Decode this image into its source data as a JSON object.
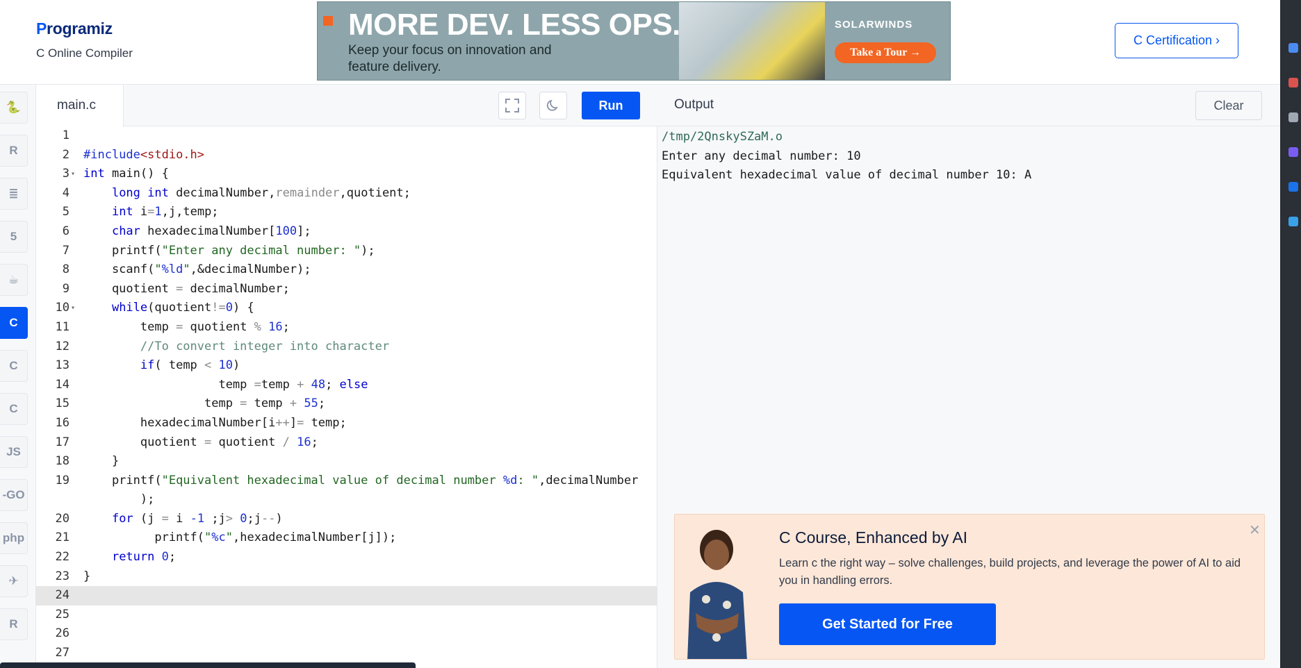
{
  "header": {
    "logo_text": "rogramiz",
    "logo_p": "P",
    "subtitle": "C Online Compiler",
    "cert_button": "C Certification ›"
  },
  "ad": {
    "headline": "MORE DEV. LESS OPS.",
    "subline": "Keep your focus on innovation and feature delivery.",
    "brand": "SOLARWINDS",
    "cta": "Take a Tour →"
  },
  "sidebar": {
    "languages": [
      {
        "name": "python-icon",
        "glyph": "🐍"
      },
      {
        "name": "r-icon",
        "glyph": "R"
      },
      {
        "name": "sql-icon",
        "glyph": "≣"
      },
      {
        "name": "html-icon",
        "glyph": "5"
      },
      {
        "name": "java-icon",
        "glyph": "☕"
      },
      {
        "name": "c-icon",
        "glyph": "C",
        "active": true
      },
      {
        "name": "cpp-icon",
        "glyph": "C"
      },
      {
        "name": "csharp-icon",
        "glyph": "C"
      },
      {
        "name": "js-icon",
        "glyph": "JS"
      },
      {
        "name": "go-icon",
        "glyph": "-GO"
      },
      {
        "name": "php-icon",
        "glyph": "php"
      },
      {
        "name": "swift-icon",
        "glyph": "✈"
      },
      {
        "name": "rust-icon",
        "glyph": "R"
      }
    ]
  },
  "editor": {
    "tab": "main.c",
    "run": "Run",
    "lines": [
      {
        "n": "1",
        "html": ""
      },
      {
        "n": "2",
        "html": "<span class=\"pp\">#include</span><span class=\"inc\">&lt;stdio.h&gt;</span>"
      },
      {
        "n": "3",
        "fold": true,
        "html": "<span class=\"kw\">int</span> main() {"
      },
      {
        "n": "4",
        "html": "    <span class=\"kw\">long</span> <span class=\"kw\">int</span> decimalNumber,<span class=\"op\">remainder</span>,quotient;"
      },
      {
        "n": "5",
        "html": "    <span class=\"kw\">int</span> i<span class=\"op\">=</span><span class=\"nm\">1</span>,j,temp;"
      },
      {
        "n": "6",
        "html": "    <span class=\"kw\">char</span> hexadecimalNumber[<span class=\"nm\">100</span>];"
      },
      {
        "n": "7",
        "html": "    printf(<span class=\"st\">\"Enter any decimal number: \"</span>);"
      },
      {
        "n": "8",
        "html": "    scanf(<span class=\"st\">\"<span class=\"nm\">%ld</span>\"</span>,&amp;decimalNumber);"
      },
      {
        "n": "9",
        "html": "    quotient <span class=\"op\">=</span> decimalNumber;"
      },
      {
        "n": "10",
        "fold": true,
        "html": "    <span class=\"kw\">while</span>(quotient<span class=\"op\">!=</span><span class=\"nm\">0</span>) {"
      },
      {
        "n": "11",
        "html": "        temp <span class=\"op\">=</span> quotient <span class=\"op\">%</span> <span class=\"nm\">16</span>;"
      },
      {
        "n": "12",
        "html": "        <span class=\"cm\">//To convert integer into character</span>"
      },
      {
        "n": "13",
        "html": "        <span class=\"kw\">if</span>( temp <span class=\"op\">&lt;</span> <span class=\"nm\">10</span>)"
      },
      {
        "n": "14",
        "html": "                   temp <span class=\"op\">=</span>temp <span class=\"op\">+</span> <span class=\"nm\">48</span>; <span class=\"kw\">else</span>"
      },
      {
        "n": "15",
        "html": "                 temp <span class=\"op\">=</span> temp <span class=\"op\">+</span> <span class=\"nm\">55</span>;"
      },
      {
        "n": "16",
        "html": "        hexadecimalNumber[i<span class=\"op\">++</span>]<span class=\"op\">=</span> temp;"
      },
      {
        "n": "17",
        "html": "        quotient <span class=\"op\">=</span> quotient <span class=\"op\">/</span> <span class=\"nm\">16</span>;"
      },
      {
        "n": "18",
        "html": "    }"
      },
      {
        "n": "19",
        "html": "    printf(<span class=\"st\">\"Equivalent hexadecimal value of decimal number <span class=\"nm\">%d</span>: \"</span>,decimalNumber"
      },
      {
        "n": "",
        "html": "        );"
      },
      {
        "n": "20",
        "html": "    <span class=\"kw\">for</span> (j <span class=\"op\">=</span> i <span class=\"nm\">-1</span> ;j<span class=\"op\">&gt;</span> <span class=\"nm\">0</span>;j<span class=\"op\">--</span>)"
      },
      {
        "n": "21",
        "html": "          printf(<span class=\"st\">\"<span class=\"nm\">%c</span>\"</span>,hexadecimalNumber[j]);"
      },
      {
        "n": "22",
        "html": "    <span class=\"kw\">return</span> <span class=\"nm\">0</span>;"
      },
      {
        "n": "23",
        "html": "}"
      },
      {
        "n": "24",
        "html": "",
        "current": true
      },
      {
        "n": "25",
        "html": ""
      },
      {
        "n": "26",
        "html": ""
      },
      {
        "n": "27",
        "html": ""
      }
    ]
  },
  "output": {
    "label": "Output",
    "clear": "Clear",
    "path": "/tmp/2QnskySZaM.o",
    "line1": "Enter any decimal number: 10",
    "line2": "Equivalent hexadecimal value of decimal number 10: A"
  },
  "promo": {
    "title": "C Course, Enhanced by AI",
    "body": "Learn c the right way – solve challenges, build projects, and leverage the power of AI to aid you in handling errors.",
    "cta": "Get Started for Free",
    "close": "✕"
  },
  "colors": {
    "accent": "#0556f3",
    "promo_bg": "#fde7d8"
  }
}
